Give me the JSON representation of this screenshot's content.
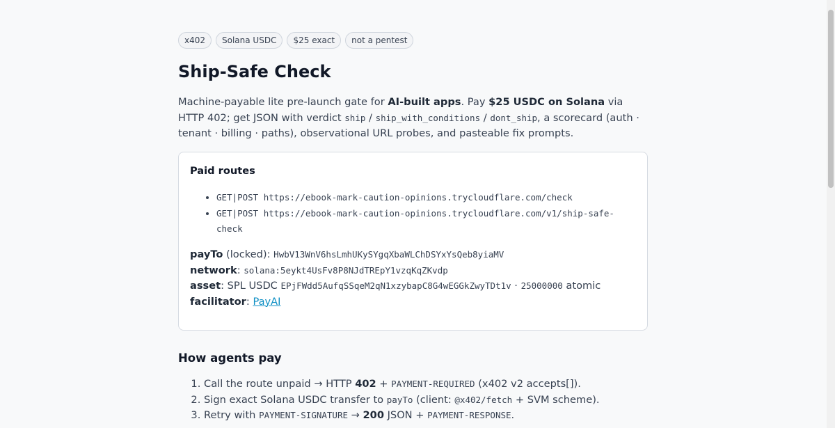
{
  "tags": [
    "x402",
    "Solana USDC",
    "$25 exact",
    "not a pentest"
  ],
  "title": "Ship-Safe Check",
  "lead": {
    "t1": "Machine-payable lite pre-launch gate for ",
    "b1": "AI-built apps",
    "t2": ". Pay ",
    "b2": "$25 USDC on Solana",
    "t3": " via HTTP 402; get JSON with verdict ",
    "c1": "ship",
    "t4": " / ",
    "c2": "ship_with_conditions",
    "t5": " / ",
    "c3": "dont_ship",
    "t6": ", a scorecard (auth · tenant · billing · paths), observational URL probes, and pasteable fix prompts."
  },
  "paid_routes": {
    "heading": "Paid routes",
    "routes": [
      "GET|POST https://ebook-mark-caution-opinions.trycloudflare.com/check",
      "GET|POST https://ebook-mark-caution-opinions.trycloudflare.com/v1/ship-safe-check"
    ],
    "payto_label": "payTo",
    "payto_suffix": " (locked): ",
    "payto_value": "HwbV13WnV6hsLmhUKySYgqXbaWLChDSYxYsQeb8yiaMV",
    "network_label": "network",
    "network_value": "solana:5eykt4UsFv8P8NJdTREpY1vzqKqZKvdp",
    "asset_label": "asset",
    "asset_text": ": SPL USDC ",
    "asset_value": "EPjFWdd5AufqSSqeM2qN1xzybapC8G4wEGGkZwyTDt1v",
    "asset_sep": " · ",
    "asset_amount": "25000000",
    "asset_unit": " atomic",
    "facilitator_label": "facilitator",
    "facilitator_value": "PayAI"
  },
  "how": {
    "heading": "How agents pay",
    "s1": {
      "t1": "Call the route unpaid → HTTP ",
      "b1": "402",
      "t2": " + ",
      "c1": "PAYMENT-REQUIRED",
      "t3": " (x402 v2 accepts[])."
    },
    "s2": {
      "t1": "Sign exact Solana USDC transfer to ",
      "c1": "payTo",
      "t2": " (client: ",
      "c2": "@x402/fetch",
      "t3": " + SVM scheme)."
    },
    "s3": {
      "t1": "Retry with ",
      "c1": "PAYMENT-SIGNATURE",
      "t2": " → ",
      "b1": "200",
      "t3": " JSON + ",
      "c2": "PAYMENT-RESPONSE",
      "t4": "."
    }
  }
}
